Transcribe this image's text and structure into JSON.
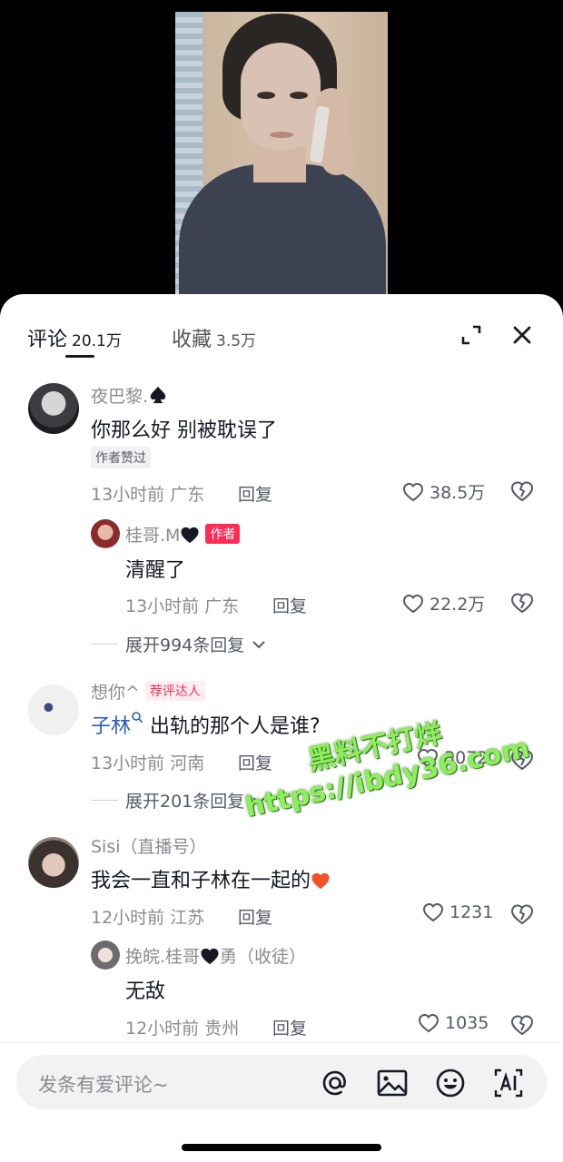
{
  "tabs": {
    "comments_label": "评论",
    "comments_count": "20.1万",
    "favorites_label": "收藏",
    "favorites_count": "3.5万"
  },
  "comments": [
    {
      "username": "夜巴黎.",
      "username_suffix_icon": "spade-icon",
      "content": "你那么好 别被耽误了",
      "badge": "作者赞过",
      "time": "13小时前",
      "location": "广东",
      "reply_label": "回复",
      "likes": "38.5万",
      "reply": {
        "username": "桂哥.M",
        "username_suffix_icon": "black-heart-icon",
        "badge": "作者",
        "content": "清醒了",
        "time": "13小时前",
        "location": "广东",
        "reply_label": "回复",
        "likes": "22.2万"
      },
      "expand_label": "展开994条回复"
    },
    {
      "username": "想你^",
      "badge": "荐评达人",
      "mention": "子林",
      "content": "出轨的那个人是谁?",
      "time": "13小时前",
      "location": "河南",
      "reply_label": "回复",
      "likes": "3072",
      "expand_label": "展开201条回复"
    },
    {
      "username": "Sisi（直播号）",
      "content": "我会一直和子林在一起的",
      "content_suffix_icon": "red-heart-emoji",
      "time": "12小时前",
      "location": "江苏",
      "reply_label": "回复",
      "likes": "1231",
      "reply": {
        "username_prefix": "挽皖.桂哥",
        "username_suffix_icon": "black-heart-icon",
        "username_rest": "勇（收徒）",
        "content": "无敌",
        "time": "12小时前",
        "location": "贵州",
        "reply_label": "回复",
        "likes": "1035"
      }
    }
  ],
  "watermark": {
    "line1": "黑料不打烊",
    "line2": "https://ibdy36.com"
  },
  "input": {
    "placeholder": "发条有爱评论~"
  }
}
